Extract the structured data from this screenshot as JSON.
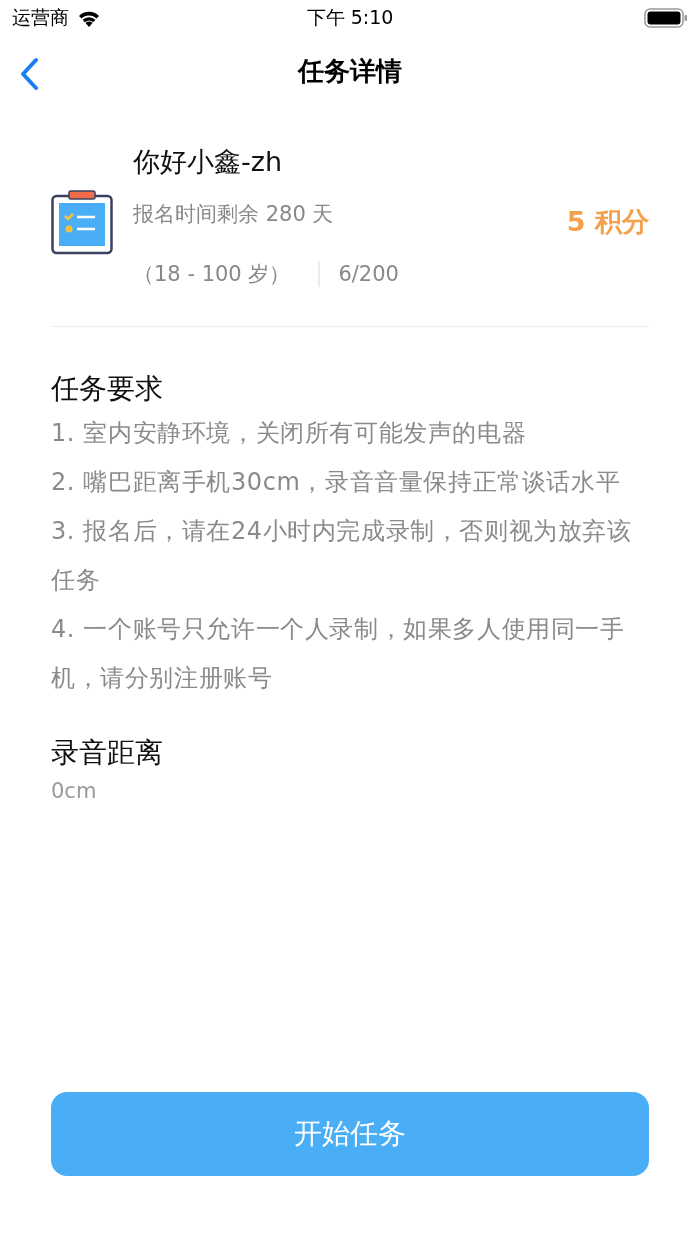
{
  "status_bar": {
    "carrier": "运营商",
    "time": "下午 5:10"
  },
  "nav": {
    "title": "任务详情"
  },
  "task": {
    "name": "你好小鑫-zh",
    "remaining": "报名时间剩余 280 天",
    "age_range": "（18 - 100 岁）",
    "quota": "6/200",
    "points": "5 积分"
  },
  "requirements": {
    "title": "任务要求",
    "items": [
      "1. 室内安静环境，关闭所有可能发声的电器",
      "2. 嘴巴距离手机30cm，录音音量保持正常谈话水平",
      "3. 报名后，请在24小时内完成录制，否则视为放弃该任务",
      "4. 一个账号只允许一个人录制，如果多人使用同一手机，请分别注册账号"
    ]
  },
  "distance": {
    "title": "录音距离",
    "value": "0cm"
  },
  "start_button": "开始任务"
}
